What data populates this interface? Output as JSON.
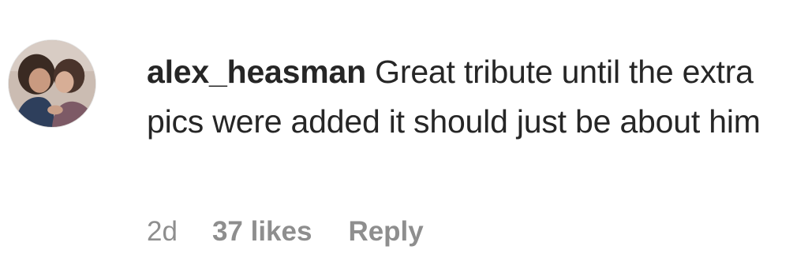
{
  "comment": {
    "username": "alex_heasman",
    "text": "Great tribute until the extra pics were added it should just be about him",
    "timestamp": "2d",
    "likes_label": "37 likes",
    "reply_label": "Reply"
  },
  "avatar": {
    "icon": "profile-photo"
  }
}
